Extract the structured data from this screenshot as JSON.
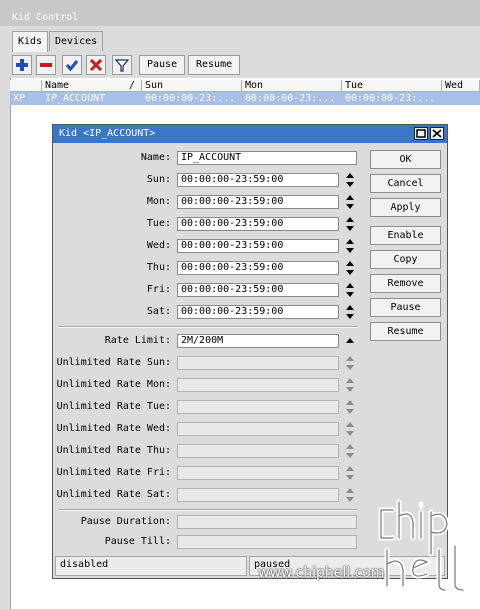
{
  "window": {
    "title": "Kid Control"
  },
  "tabs": [
    "Kids",
    "Devices"
  ],
  "toolbar": {
    "add_icon": "plus-icon",
    "remove_icon": "minus-icon",
    "enable_icon": "check-icon",
    "disable_icon": "x-icon",
    "filter_icon": "filter-icon",
    "pause_label": "Pause",
    "resume_label": "Resume"
  },
  "grid": {
    "columns": [
      "Name",
      "Sun",
      "Mon",
      "Tue",
      "Wed"
    ],
    "sort_indicator": "/",
    "row": {
      "flag": "XP",
      "name": "IP_ACCOUNT",
      "sun": "00:00:00-23:...",
      "mon": "00:00:00-23:...",
      "tue": "00:00:00-23:..."
    }
  },
  "dialog": {
    "title": "Kid <IP_ACCOUNT>",
    "name_label": "Name:",
    "name_value": "IP_ACCOUNT",
    "days": [
      {
        "label": "Sun:",
        "value": "00:00:00-23:59:00"
      },
      {
        "label": "Mon:",
        "value": "00:00:00-23:59:00"
      },
      {
        "label": "Tue:",
        "value": "00:00:00-23:59:00"
      },
      {
        "label": "Wed:",
        "value": "00:00:00-23:59:00"
      },
      {
        "label": "Thu:",
        "value": "00:00:00-23:59:00"
      },
      {
        "label": "Fri:",
        "value": "00:00:00-23:59:00"
      },
      {
        "label": "Sat:",
        "value": "00:00:00-23:59:00"
      }
    ],
    "rate_limit_label": "Rate Limit:",
    "rate_limit_value": "2M/200M",
    "unlimited": [
      "Unlimited Rate Sun:",
      "Unlimited Rate Mon:",
      "Unlimited Rate Tue:",
      "Unlimited Rate Wed:",
      "Unlimited Rate Thu:",
      "Unlimited Rate Fri:",
      "Unlimited Rate Sat:"
    ],
    "pause_duration_label": "Pause Duration:",
    "pause_till_label": "Pause Till:",
    "buttons": [
      "OK",
      "Cancel",
      "Apply",
      "Enable",
      "Copy",
      "Remove",
      "Pause",
      "Resume"
    ],
    "status_left": "disabled",
    "status_right": "paused"
  },
  "watermark": {
    "url": "www.chiphell.com"
  },
  "colors": {
    "title_bar": "#3a77c9",
    "selected_row": "#a8bfe6",
    "add_icon": "#1f4fb0",
    "remove_icon": "#c81818"
  }
}
